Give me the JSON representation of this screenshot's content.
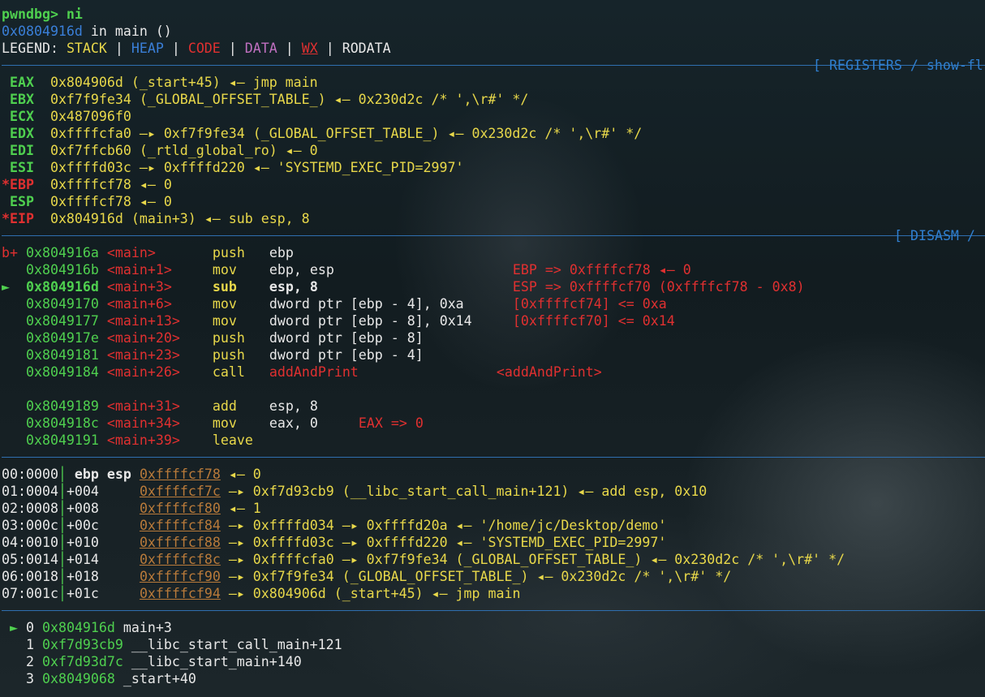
{
  "prompt": {
    "text": "pwndbg> ni"
  },
  "location": {
    "addr": "0x0804916d",
    "rest": " in main ()"
  },
  "legend": {
    "label": "LEGEND: ",
    "stack": "STACK",
    "heap": "HEAP",
    "code": "CODE",
    "data": "DATA",
    "wx": "WX",
    "rodata": "RODATA",
    "sep": " | "
  },
  "sections": {
    "registers": "[ REGISTERS / show-fl",
    "disasm": "[ DISASM /"
  },
  "registers": [
    {
      "name": " EAX",
      "value": "0x804906d (_start+45) ◂— jmp main"
    },
    {
      "name": " EBX",
      "value": "0xf7f9fe34 (_GLOBAL_OFFSET_TABLE_) ◂— 0x230d2c /* ',\\r#' */"
    },
    {
      "name": " ECX",
      "value": "0x487096f0"
    },
    {
      "name": " EDX",
      "value": "0xffffcfa0 —▸ 0xf7f9fe34 (_GLOBAL_OFFSET_TABLE_) ◂— 0x230d2c /* ',\\r#' */"
    },
    {
      "name": " EDI",
      "value": "0xf7ffcb60 (_rtld_global_ro) ◂— 0"
    },
    {
      "name": " ESI",
      "value": "0xffffd03c —▸ 0xffffd220 ◂— 'SYSTEMD_EXEC_PID=2997'"
    },
    {
      "name": "*EBP",
      "value": "0xffffcf78 ◂— 0"
    },
    {
      "name": " ESP",
      "value": "0xffffcf78 ◂— 0"
    },
    {
      "name": "*EIP",
      "value": "0x804916d (main+3) ◂— sub esp, 8"
    }
  ],
  "disasm": [
    {
      "mark": "b+",
      "addr": "0x804916a",
      "sym": "<main>",
      "op": "push",
      "args": "ebp",
      "note": ""
    },
    {
      "mark": "",
      "addr": "0x804916b",
      "sym": "<main+1>",
      "op": "mov",
      "args": "ebp, esp",
      "note": "EBP => 0xffffcf78 ◂— 0"
    },
    {
      "mark": "►",
      "addr": "0x804916d",
      "sym": "<main+3>",
      "op": "sub",
      "args": "esp, 8",
      "note": "ESP => 0xffffcf70 (0xffffcf78 - 0x8)"
    },
    {
      "mark": "",
      "addr": "0x8049170",
      "sym": "<main+6>",
      "op": "mov",
      "args": "dword ptr [ebp - 4], 0xa",
      "note": "[0xffffcf74] <= 0xa"
    },
    {
      "mark": "",
      "addr": "0x8049177",
      "sym": "<main+13>",
      "op": "mov",
      "args": "dword ptr [ebp - 8], 0x14",
      "note": "[0xffffcf70] <= 0x14"
    },
    {
      "mark": "",
      "addr": "0x804917e",
      "sym": "<main+20>",
      "op": "push",
      "args": "dword ptr [ebp - 8]",
      "note": ""
    },
    {
      "mark": "",
      "addr": "0x8049181",
      "sym": "<main+23>",
      "op": "push",
      "args": "dword ptr [ebp - 4]",
      "note": ""
    },
    {
      "mark": "",
      "addr": "0x8049184",
      "sym": "<main+26>",
      "op": "call",
      "args": "addAndPrint",
      "note": "<addAndPrint>"
    },
    {
      "mark": "",
      "addr": "0x8049189",
      "sym": "<main+31>",
      "op": "add",
      "args": "esp, 8",
      "note": ""
    },
    {
      "mark": "",
      "addr": "0x804918c",
      "sym": "<main+34>",
      "op": "mov",
      "args": "eax, 0",
      "note": "EAX => 0"
    },
    {
      "mark": "",
      "addr": "0x8049191",
      "sym": "<main+39>",
      "op": "leave",
      "args": "",
      "note": ""
    }
  ],
  "stack": [
    {
      "idx": "00:0000",
      "off": " ebp esp",
      "addr": "0xffffcf78",
      "rest": " ◂— 0"
    },
    {
      "idx": "01:0004",
      "off": "+004",
      "addr": "0xffffcf7c",
      "rest": " —▸ 0xf7d93cb9 (__libc_start_call_main+121) ◂— add esp, 0x10"
    },
    {
      "idx": "02:0008",
      "off": "+008",
      "addr": "0xffffcf80",
      "rest": " ◂— 1"
    },
    {
      "idx": "03:000c",
      "off": "+00c",
      "addr": "0xffffcf84",
      "rest": " —▸ 0xffffd034 —▸ 0xffffd20a ◂— '/home/jc/Desktop/demo'"
    },
    {
      "idx": "04:0010",
      "off": "+010",
      "addr": "0xffffcf88",
      "rest": " —▸ 0xffffd03c —▸ 0xffffd220 ◂— 'SYSTEMD_EXEC_PID=2997'"
    },
    {
      "idx": "05:0014",
      "off": "+014",
      "addr": "0xffffcf8c",
      "rest": " —▸ 0xffffcfa0 —▸ 0xf7f9fe34 (_GLOBAL_OFFSET_TABLE_) ◂— 0x230d2c /* ',\\r#' */"
    },
    {
      "idx": "06:0018",
      "off": "+018",
      "addr": "0xffffcf90",
      "rest": " —▸ 0xf7f9fe34 (_GLOBAL_OFFSET_TABLE_) ◂— 0x230d2c /* ',\\r#' */"
    },
    {
      "idx": "07:001c",
      "off": "+01c",
      "addr": "0xffffcf94",
      "rest": " —▸ 0x804906d (_start+45) ◂— jmp main"
    }
  ],
  "backtrace": [
    {
      "mark": " ► ",
      "idx": "0",
      "addr": "0x804916d",
      "sym": "main+3"
    },
    {
      "mark": "   ",
      "idx": "1",
      "addr": "0xf7d93cb9",
      "sym": "__libc_start_call_main+121"
    },
    {
      "mark": "   ",
      "idx": "2",
      "addr": "0xf7d93d7c",
      "sym": "__libc_start_main+140"
    },
    {
      "mark": "   ",
      "idx": "3",
      "addr": "0x8049068",
      "sym": "_start+40"
    }
  ]
}
